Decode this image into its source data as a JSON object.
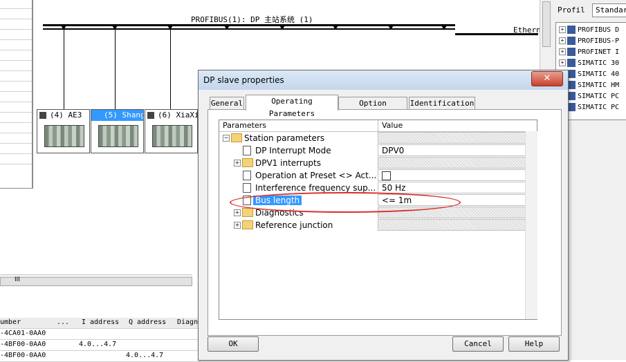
{
  "bus": {
    "title": "PROFIBUS(1): DP 主站系统 (1)",
    "ethernet_label": "Ethern"
  },
  "slaves": [
    {
      "label": "(4) AE3"
    },
    {
      "label": "(5) Shang"
    },
    {
      "label": "(6) XiaXi"
    }
  ],
  "bottom_table": {
    "headers": [
      "umber",
      "...",
      "I address",
      "Q address",
      "Diagn"
    ],
    "rows": [
      {
        "number": "-4CA01-0AA0",
        "i_address": "",
        "q_address": ""
      },
      {
        "number": "-4BF00-0AA0",
        "i_address": "4.0...4.7",
        "q_address": ""
      },
      {
        "number": "-4BF00-0AA0",
        "i_address": "",
        "q_address": "4.0...4.7"
      }
    ]
  },
  "right_panel": {
    "profile_label": "Profil",
    "profile_value": "Standar",
    "catalog": [
      {
        "label": "PROFIBUS D"
      },
      {
        "label": "PROFIBUS-P"
      },
      {
        "label": "PROFINET I"
      },
      {
        "label": "SIMATIC 30"
      },
      {
        "label": "SIMATIC 40"
      },
      {
        "label": "SIMATIC HM"
      },
      {
        "label": "SIMATIC PC"
      },
      {
        "label": "SIMATIC PC"
      }
    ]
  },
  "dialog": {
    "title": "DP slave properties",
    "close_glyph": "✕",
    "tabs": [
      {
        "label": "General"
      },
      {
        "label": "Operating Parameters"
      },
      {
        "label": "Option Handling"
      },
      {
        "label": "Identification"
      }
    ],
    "grid_header": {
      "parameters": "Parameters",
      "value": "Value"
    },
    "rows": [
      {
        "name": "Station parameters",
        "value": ""
      },
      {
        "name": "DP Interrupt Mode",
        "value": "DPV0"
      },
      {
        "name": "DPV1 interrupts",
        "value": ""
      },
      {
        "name": "Operation at Preset <> Act...",
        "value": ""
      },
      {
        "name": "Interference frequency sup...",
        "value": "50 Hz"
      },
      {
        "name": "Bus length",
        "value": "<= 1m"
      },
      {
        "name": "Diagnostics",
        "value": ""
      },
      {
        "name": "Reference junction",
        "value": ""
      }
    ],
    "buttons": {
      "ok": "OK",
      "cancel": "Cancel",
      "help": "Help"
    }
  },
  "scroll_label": "III",
  "accent_colors": {
    "selection": "#3399ff",
    "annotation": "#d9312b"
  }
}
